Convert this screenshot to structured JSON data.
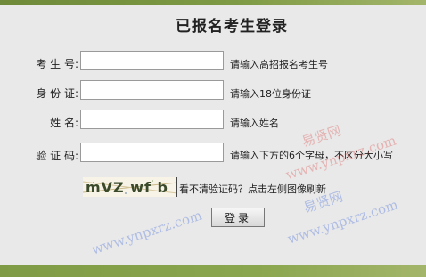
{
  "header": {
    "title": "已报名考生登录"
  },
  "form": {
    "rows": [
      {
        "label": "考 生 号:",
        "value": "",
        "hint": "请输入高招报名考生号"
      },
      {
        "label": "身 份 证:",
        "value": "",
        "hint": "请输入18位身份证"
      },
      {
        "label": "姓 名:",
        "value": "",
        "hint": "请输入姓名"
      },
      {
        "label": "验 证 码:",
        "value": "",
        "hint": "请输入下方的6个字母，不区分大小写"
      }
    ],
    "captcha": {
      "text": "mVZ wf b",
      "note": "看不清验证码？点击左侧图像刷新"
    },
    "login_label": "登录"
  },
  "watermarks": {
    "brand_cn": "易贤网",
    "brand_url": "www.ynpxrz.com"
  },
  "colors": {
    "background": "#e9e9e9",
    "bar_green": "#7e9a44",
    "watermark_red": "#dc5050",
    "watermark_blue": "#466edc"
  }
}
